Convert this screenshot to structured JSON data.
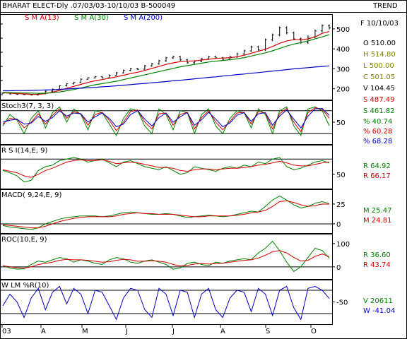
{
  "header": {
    "title": "BHARAT ELECT-Dly .07/03/03-10/10/03  B-500049",
    "right_label": "TREND",
    "sma_legend": [
      {
        "label": "S M A(13)",
        "color": "#d00000"
      },
      {
        "label": "S M A(30)",
        "color": "#008000"
      },
      {
        "label": "S M A(200)",
        "color": "#0000c0"
      }
    ]
  },
  "colors": {
    "price": "#000000",
    "red": "#d00000",
    "green": "#008000",
    "blue": "#0000c0"
  },
  "x_axis": {
    "ticks": [
      "03",
      "A",
      "M",
      "J",
      "J",
      "A",
      "S",
      "O"
    ]
  },
  "chart_data": [
    {
      "type": "ohlc",
      "name": "price",
      "x": [
        0,
        10,
        20,
        30,
        40,
        50,
        60,
        70,
        80,
        90,
        100,
        110,
        120,
        130,
        140,
        150,
        160,
        170,
        180,
        190,
        200,
        210,
        220,
        230,
        240,
        250,
        260,
        270,
        280,
        290,
        300,
        310,
        320,
        330,
        340,
        350,
        360,
        370,
        380,
        390,
        400,
        410,
        420,
        430,
        440,
        450,
        460
      ],
      "close": [
        178,
        174,
        172,
        171,
        169,
        175,
        188,
        198,
        215,
        225,
        232,
        248,
        255,
        260,
        255,
        268,
        280,
        292,
        300,
        298,
        315,
        325,
        340,
        355,
        360,
        345,
        330,
        338,
        350,
        360,
        355,
        348,
        360,
        375,
        390,
        410,
        395,
        445,
        470,
        505,
        480,
        450,
        432,
        460,
        490,
        515,
        505
      ],
      "sma13": [
        180,
        178,
        176,
        174,
        172,
        172,
        176,
        183,
        192,
        202,
        212,
        222,
        232,
        240,
        246,
        253,
        260,
        268,
        276,
        283,
        292,
        302,
        312,
        322,
        330,
        336,
        338,
        340,
        344,
        348,
        352,
        354,
        356,
        360,
        368,
        378,
        388,
        398,
        412,
        428,
        440,
        446,
        446,
        450,
        460,
        478,
        487
      ],
      "sma30": [
        182,
        181,
        180,
        179,
        178,
        177,
        178,
        180,
        184,
        190,
        196,
        204,
        212,
        220,
        226,
        232,
        238,
        246,
        254,
        262,
        270,
        278,
        286,
        294,
        302,
        310,
        316,
        322,
        328,
        334,
        338,
        342,
        346,
        350,
        356,
        364,
        372,
        380,
        390,
        402,
        414,
        424,
        432,
        440,
        450,
        460,
        471
      ],
      "sma200": [
        190,
        190,
        191,
        191,
        192,
        193,
        194,
        195,
        197,
        199,
        201,
        203,
        205,
        207,
        210,
        212,
        215,
        218,
        221,
        224,
        227,
        230,
        233,
        236,
        240,
        243,
        246,
        250,
        253,
        257,
        260,
        264,
        267,
        271,
        274,
        278,
        281,
        285,
        289,
        292,
        296,
        300,
        303,
        306,
        309,
        312,
        315
      ],
      "y_ticks": [
        200,
        300,
        400,
        500
      ],
      "ylim": [
        160,
        560
      ],
      "info": {
        "date": "F 10/10/03",
        "values": [
          {
            "label": "O  510.00",
            "color": "#000000"
          },
          {
            "label": "H  514.80",
            "color": "#808000"
          },
          {
            "label": "L  500.00",
            "color": "#808000"
          },
          {
            "label": "C  501.05",
            "color": "#808000"
          },
          {
            "label": "V  104.45",
            "color": "#000000"
          },
          {
            "label": "S  487.49",
            "color": "#d00000"
          },
          {
            "label": "S  461.82",
            "color": "#008000"
          }
        ]
      }
    },
    {
      "type": "line",
      "name": "Stoch3(7, 3, 3)",
      "x": [
        0,
        10,
        20,
        30,
        40,
        50,
        60,
        70,
        80,
        90,
        100,
        110,
        120,
        130,
        140,
        150,
        160,
        170,
        180,
        190,
        200,
        210,
        220,
        230,
        240,
        250,
        260,
        270,
        280,
        290,
        300,
        310,
        320,
        330,
        340,
        350,
        360,
        370,
        380,
        390,
        400,
        410,
        420,
        430,
        440,
        450,
        460
      ],
      "series": [
        {
          "color": "#008000",
          "values": [
            40,
            70,
            55,
            20,
            60,
            80,
            35,
            75,
            90,
            50,
            85,
            70,
            30,
            80,
            75,
            45,
            15,
            60,
            85,
            80,
            40,
            20,
            85,
            70,
            30,
            80,
            75,
            20,
            70,
            85,
            40,
            20,
            60,
            80,
            75,
            35,
            85,
            70,
            20,
            80,
            90,
            40,
            15,
            85,
            90,
            80,
            40.74
          ]
        },
        {
          "color": "#d00000",
          "values": [
            45,
            60,
            58,
            35,
            50,
            72,
            45,
            68,
            85,
            60,
            78,
            72,
            42,
            70,
            76,
            55,
            28,
            50,
            78,
            82,
            50,
            32,
            72,
            74,
            42,
            70,
            76,
            32,
            62,
            80,
            50,
            30,
            52,
            74,
            76,
            45,
            78,
            74,
            32,
            72,
            86,
            50,
            25,
            75,
            88,
            84,
            60.28
          ]
        },
        {
          "color": "#0000c0",
          "values": [
            50,
            55,
            58,
            45,
            48,
            65,
            52,
            62,
            80,
            66,
            74,
            72,
            50,
            64,
            74,
            60,
            38,
            45,
            70,
            80,
            58,
            40,
            62,
            74,
            50,
            64,
            75,
            42,
            56,
            76,
            58,
            38,
            48,
            68,
            75,
            52,
            72,
            75,
            42,
            66,
            82,
            58,
            35,
            66,
            85,
            86,
            68.28
          ]
        }
      ],
      "ylim": [
        0,
        100
      ],
      "hlines": [
        20,
        80
      ],
      "y_ticks": [
        50
      ],
      "info": [
        {
          "label": "%   40.74",
          "color": "#008000"
        },
        {
          "label": "%   60.28",
          "color": "#d00000"
        },
        {
          "label": "%   68.28",
          "color": "#0000c0"
        }
      ]
    },
    {
      "type": "line",
      "name": "R S I(14,E, 9)",
      "x": [
        0,
        10,
        20,
        30,
        40,
        50,
        60,
        70,
        80,
        90,
        100,
        110,
        120,
        130,
        140,
        150,
        160,
        170,
        180,
        190,
        200,
        210,
        220,
        230,
        240,
        250,
        260,
        270,
        280,
        290,
        300,
        310,
        320,
        330,
        340,
        350,
        360,
        370,
        380,
        390,
        400,
        410,
        420,
        430,
        440,
        450,
        460
      ],
      "series": [
        {
          "color": "#008000",
          "values": [
            55,
            52,
            48,
            40,
            42,
            55,
            60,
            62,
            68,
            70,
            72,
            70,
            66,
            68,
            70,
            65,
            60,
            66,
            68,
            64,
            60,
            58,
            56,
            60,
            55,
            50,
            52,
            60,
            58,
            56,
            54,
            58,
            60,
            58,
            62,
            60,
            66,
            64,
            70,
            72,
            60,
            56,
            58,
            62,
            66,
            68,
            64.92
          ]
        },
        {
          "color": "#d00000",
          "values": [
            56,
            54,
            52,
            48,
            46,
            50,
            55,
            58,
            62,
            66,
            68,
            69,
            68,
            68,
            69,
            67,
            64,
            65,
            66,
            65,
            63,
            61,
            59,
            59,
            58,
            55,
            54,
            56,
            57,
            57,
            56,
            57,
            58,
            58,
            59,
            60,
            62,
            63,
            65,
            67,
            65,
            62,
            61,
            61,
            63,
            65,
            66.17
          ]
        }
      ],
      "ylim": [
        35,
        85
      ],
      "hlines": [
        70
      ],
      "y_ticks": [
        50
      ],
      "info": [
        {
          "label": "R   64.92",
          "color": "#008000"
        },
        {
          "label": "R   66.17",
          "color": "#d00000"
        }
      ]
    },
    {
      "type": "line",
      "name": "MACD( 9,24,E, 9)",
      "x": [
        0,
        10,
        20,
        30,
        40,
        50,
        60,
        70,
        80,
        90,
        100,
        110,
        120,
        130,
        140,
        150,
        160,
        170,
        180,
        190,
        200,
        210,
        220,
        230,
        240,
        250,
        260,
        270,
        280,
        290,
        300,
        310,
        320,
        330,
        340,
        350,
        360,
        370,
        380,
        390,
        400,
        410,
        420,
        430,
        440,
        450,
        460
      ],
      "series": [
        {
          "color": "#008000",
          "values": [
            -2,
            -4,
            -5,
            -6,
            -7,
            -5,
            0,
            3,
            6,
            8,
            9,
            10,
            10,
            10,
            9,
            10,
            12,
            14,
            15,
            14,
            13,
            12,
            12,
            13,
            12,
            10,
            8,
            9,
            10,
            11,
            10,
            9,
            10,
            12,
            14,
            16,
            15,
            22,
            30,
            35,
            30,
            24,
            20,
            22,
            26,
            28,
            25.47
          ]
        },
        {
          "color": "#d00000",
          "values": [
            -1,
            -2,
            -3,
            -4,
            -5,
            -5,
            -3,
            0,
            3,
            5,
            7,
            8,
            9,
            9,
            9,
            9,
            10,
            12,
            13,
            14,
            13,
            13,
            12,
            12,
            12,
            11,
            10,
            9,
            9,
            10,
            10,
            10,
            10,
            11,
            12,
            14,
            15,
            17,
            22,
            28,
            29,
            27,
            24,
            22,
            23,
            25,
            24.81
          ]
        }
      ],
      "ylim": [
        -8,
        40
      ],
      "hlines": [
        0
      ],
      "y_ticks": [
        25,
        0
      ],
      "info": [
        {
          "label": "M   25.47",
          "color": "#008000"
        },
        {
          "label": "M   24.81",
          "color": "#d00000"
        }
      ]
    },
    {
      "type": "line",
      "name": "ROC(10,E, 9)",
      "x": [
        0,
        10,
        20,
        30,
        40,
        50,
        60,
        70,
        80,
        90,
        100,
        110,
        120,
        130,
        140,
        150,
        160,
        170,
        180,
        190,
        200,
        210,
        220,
        230,
        240,
        250,
        260,
        270,
        280,
        290,
        300,
        310,
        320,
        330,
        340,
        350,
        360,
        370,
        380,
        390,
        400,
        410,
        420,
        430,
        440,
        450,
        460
      ],
      "series": [
        {
          "color": "#008000",
          "values": [
            5,
            -5,
            -10,
            -8,
            10,
            25,
            20,
            30,
            40,
            35,
            20,
            30,
            25,
            15,
            10,
            30,
            40,
            35,
            20,
            15,
            25,
            30,
            20,
            10,
            -10,
            -5,
            15,
            20,
            10,
            5,
            20,
            15,
            25,
            30,
            35,
            30,
            60,
            80,
            110,
            70,
            20,
            -20,
            0,
            40,
            80,
            70,
            36.6
          ]
        },
        {
          "color": "#d00000",
          "values": [
            5,
            0,
            -4,
            -6,
            0,
            10,
            15,
            20,
            28,
            32,
            30,
            30,
            28,
            24,
            20,
            22,
            28,
            32,
            30,
            24,
            24,
            26,
            24,
            20,
            10,
            4,
            6,
            12,
            14,
            12,
            14,
            16,
            20,
            24,
            28,
            30,
            38,
            50,
            65,
            70,
            60,
            40,
            25,
            28,
            45,
            55,
            43.74
          ]
        }
      ],
      "ylim": [
        -40,
        130
      ],
      "hlines": [
        0
      ],
      "y_ticks": [
        100,
        0
      ],
      "info": [
        {
          "label": "R   36.60",
          "color": "#008000"
        },
        {
          "label": "R   43.74",
          "color": "#d00000"
        }
      ]
    },
    {
      "type": "line",
      "name": "W LM %R(10)",
      "x": [
        0,
        10,
        20,
        30,
        40,
        50,
        60,
        70,
        80,
        90,
        100,
        110,
        120,
        130,
        140,
        150,
        160,
        170,
        180,
        190,
        200,
        210,
        220,
        230,
        240,
        250,
        260,
        270,
        280,
        290,
        300,
        310,
        320,
        330,
        340,
        350,
        360,
        370,
        380,
        390,
        400,
        410,
        420,
        430,
        440,
        450,
        460
      ],
      "series": [
        {
          "color": "#0000c0",
          "values": [
            -60,
            -30,
            -50,
            -90,
            -40,
            -15,
            -70,
            -25,
            -10,
            -55,
            -15,
            -30,
            -80,
            -20,
            -25,
            -60,
            -95,
            -40,
            -15,
            -20,
            -70,
            -90,
            -15,
            -30,
            -85,
            -20,
            -25,
            -90,
            -30,
            -15,
            -70,
            -90,
            -40,
            -20,
            -25,
            -75,
            -15,
            -30,
            -85,
            -20,
            -10,
            -65,
            -95,
            -15,
            -10,
            -20,
            -41.04
          ]
        }
      ],
      "ylim": [
        -100,
        0
      ],
      "hlines": [
        -20,
        -80
      ],
      "y_ticks": [
        -50
      ],
      "info": [
        {
          "label": "V   20611",
          "color": "#008000"
        },
        {
          "label": "W   -41.04",
          "color": "#0000c0"
        }
      ]
    }
  ]
}
